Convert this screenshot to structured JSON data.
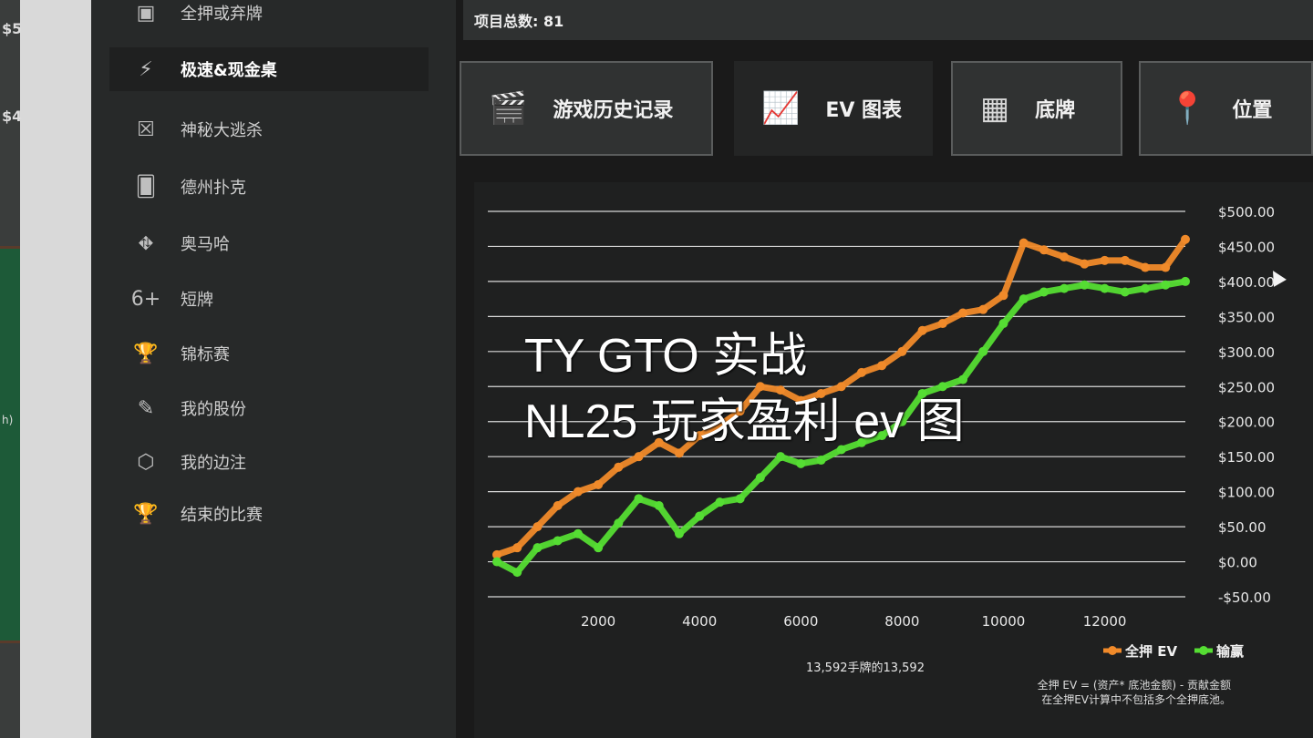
{
  "background_window": {
    "edge_texts": [
      "$5",
      "$4",
      "h)"
    ]
  },
  "sidebar": {
    "items": [
      {
        "label": "全押或弃牌",
        "icon": "allin-fold-icon",
        "active": false
      },
      {
        "label": "极速&现金桌",
        "icon": "speed-cash-icon",
        "active": true
      },
      {
        "label": "神秘大逃杀",
        "icon": "mystery-battle-icon",
        "active": false
      },
      {
        "label": "德州扑克",
        "icon": "cards-icon",
        "active": false
      },
      {
        "label": "奥马哈",
        "icon": "omaha-cards-icon",
        "active": false
      },
      {
        "label": "短牌",
        "icon": "six-plus-icon",
        "active": false
      },
      {
        "label": "锦标赛",
        "icon": "trophy-icon",
        "active": false
      },
      {
        "label": "我的股份",
        "icon": "stake-user-icon",
        "active": false
      },
      {
        "label": "我的边注",
        "icon": "side-bet-icon",
        "active": false
      },
      {
        "label": "结束的比赛",
        "icon": "finished-trophy-icon",
        "active": false
      }
    ]
  },
  "topbar": {
    "label": "项目总数: 81"
  },
  "tabs": [
    {
      "label": "游戏历史记录",
      "icon": "clapperboard-icon",
      "active": false
    },
    {
      "label": "EV 图表",
      "icon": "line-chart-icon",
      "active": true
    },
    {
      "label": "底牌",
      "icon": "grid-icon",
      "active": false
    },
    {
      "label": "位置",
      "icon": "location-pin-icon",
      "active": false
    }
  ],
  "overlay": {
    "line1": "TY GTO 实战",
    "line2": "NL25 玩家盈利 ev 图"
  },
  "chart_data": {
    "type": "line",
    "x_ticks": [
      2000,
      4000,
      6000,
      8000,
      10000,
      12000
    ],
    "y_ticks": [
      "$500.00",
      "$450.00",
      "$400.00",
      "$350.00",
      "$300.00",
      "$250.00",
      "$200.00",
      "$150.00",
      "$100.00",
      "$50.00",
      "$0.00",
      "-$50.00"
    ],
    "xlim": [
      0,
      13592
    ],
    "ylim": [
      -50,
      500
    ],
    "grid": true,
    "legend_position": "bottom-right",
    "series": [
      {
        "name": "全押 EV",
        "color": "#f08a2a",
        "x": [
          0,
          400,
          800,
          1200,
          1600,
          2000,
          2400,
          2800,
          3200,
          3600,
          4000,
          4400,
          4800,
          5200,
          5600,
          6000,
          6400,
          6800,
          7200,
          7600,
          8000,
          8400,
          8800,
          9200,
          9600,
          10000,
          10400,
          10800,
          11200,
          11600,
          12000,
          12400,
          12800,
          13200,
          13592
        ],
        "y": [
          10,
          20,
          50,
          80,
          100,
          110,
          135,
          150,
          170,
          155,
          180,
          195,
          215,
          250,
          245,
          230,
          240,
          250,
          270,
          280,
          300,
          330,
          340,
          355,
          360,
          380,
          455,
          445,
          435,
          425,
          430,
          430,
          420,
          420,
          460
        ]
      },
      {
        "name": "输赢",
        "color": "#55dd33",
        "x": [
          0,
          400,
          800,
          1200,
          1600,
          2000,
          2400,
          2800,
          3200,
          3600,
          4000,
          4400,
          4800,
          5200,
          5600,
          6000,
          6400,
          6800,
          7200,
          7600,
          8000,
          8400,
          8800,
          9200,
          9600,
          10000,
          10400,
          10800,
          11200,
          11600,
          12000,
          12400,
          12800,
          13200,
          13592
        ],
        "y": [
          0,
          -15,
          20,
          30,
          40,
          20,
          55,
          90,
          80,
          40,
          65,
          85,
          90,
          120,
          150,
          140,
          145,
          160,
          170,
          180,
          200,
          240,
          250,
          260,
          300,
          340,
          375,
          385,
          390,
          395,
          390,
          385,
          390,
          395,
          400
        ]
      }
    ],
    "xlabel": "13,592手牌的13,592"
  },
  "footnote": {
    "line1": "全押 EV = (资产* 底池金额) - 贡献金额",
    "line2": "在全押EV计算中不包括多个全押底池。"
  }
}
